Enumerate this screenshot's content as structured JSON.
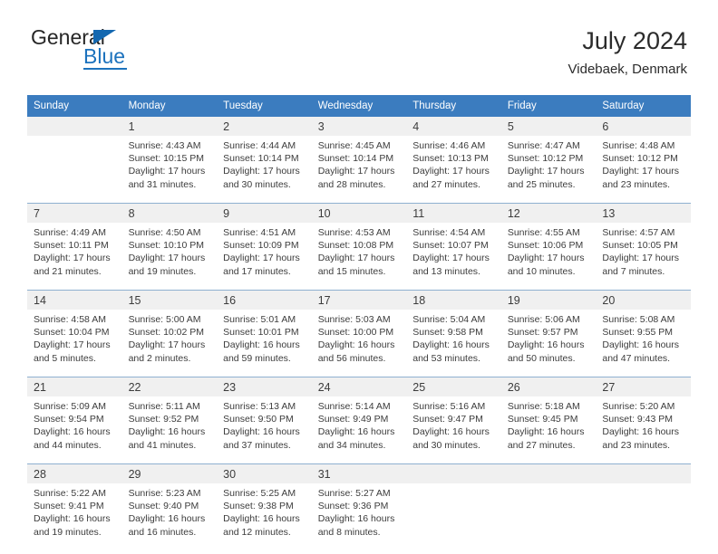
{
  "brand": {
    "name_top": "General",
    "name_bottom": "Blue",
    "accent_color": "#1c72bd"
  },
  "header": {
    "title": "July 2024",
    "subtitle": "Videbaek, Denmark"
  },
  "theme": {
    "header_blue": "#3b7cbf",
    "daynum_bg": "#f0f0f0",
    "row_divider": "#8fb0d0",
    "text": "#3c3c3c"
  },
  "calendar": {
    "weekday_headers": [
      "Sunday",
      "Monday",
      "Tuesday",
      "Wednesday",
      "Thursday",
      "Friday",
      "Saturday"
    ],
    "weeks": [
      [
        {
          "day": "",
          "sunrise": "",
          "sunset": "",
          "daylight_1": "",
          "daylight_2": ""
        },
        {
          "day": "1",
          "sunrise": "Sunrise: 4:43 AM",
          "sunset": "Sunset: 10:15 PM",
          "daylight_1": "Daylight: 17 hours",
          "daylight_2": "and 31 minutes."
        },
        {
          "day": "2",
          "sunrise": "Sunrise: 4:44 AM",
          "sunset": "Sunset: 10:14 PM",
          "daylight_1": "Daylight: 17 hours",
          "daylight_2": "and 30 minutes."
        },
        {
          "day": "3",
          "sunrise": "Sunrise: 4:45 AM",
          "sunset": "Sunset: 10:14 PM",
          "daylight_1": "Daylight: 17 hours",
          "daylight_2": "and 28 minutes."
        },
        {
          "day": "4",
          "sunrise": "Sunrise: 4:46 AM",
          "sunset": "Sunset: 10:13 PM",
          "daylight_1": "Daylight: 17 hours",
          "daylight_2": "and 27 minutes."
        },
        {
          "day": "5",
          "sunrise": "Sunrise: 4:47 AM",
          "sunset": "Sunset: 10:12 PM",
          "daylight_1": "Daylight: 17 hours",
          "daylight_2": "and 25 minutes."
        },
        {
          "day": "6",
          "sunrise": "Sunrise: 4:48 AM",
          "sunset": "Sunset: 10:12 PM",
          "daylight_1": "Daylight: 17 hours",
          "daylight_2": "and 23 minutes."
        }
      ],
      [
        {
          "day": "7",
          "sunrise": "Sunrise: 4:49 AM",
          "sunset": "Sunset: 10:11 PM",
          "daylight_1": "Daylight: 17 hours",
          "daylight_2": "and 21 minutes."
        },
        {
          "day": "8",
          "sunrise": "Sunrise: 4:50 AM",
          "sunset": "Sunset: 10:10 PM",
          "daylight_1": "Daylight: 17 hours",
          "daylight_2": "and 19 minutes."
        },
        {
          "day": "9",
          "sunrise": "Sunrise: 4:51 AM",
          "sunset": "Sunset: 10:09 PM",
          "daylight_1": "Daylight: 17 hours",
          "daylight_2": "and 17 minutes."
        },
        {
          "day": "10",
          "sunrise": "Sunrise: 4:53 AM",
          "sunset": "Sunset: 10:08 PM",
          "daylight_1": "Daylight: 17 hours",
          "daylight_2": "and 15 minutes."
        },
        {
          "day": "11",
          "sunrise": "Sunrise: 4:54 AM",
          "sunset": "Sunset: 10:07 PM",
          "daylight_1": "Daylight: 17 hours",
          "daylight_2": "and 13 minutes."
        },
        {
          "day": "12",
          "sunrise": "Sunrise: 4:55 AM",
          "sunset": "Sunset: 10:06 PM",
          "daylight_1": "Daylight: 17 hours",
          "daylight_2": "and 10 minutes."
        },
        {
          "day": "13",
          "sunrise": "Sunrise: 4:57 AM",
          "sunset": "Sunset: 10:05 PM",
          "daylight_1": "Daylight: 17 hours",
          "daylight_2": "and 7 minutes."
        }
      ],
      [
        {
          "day": "14",
          "sunrise": "Sunrise: 4:58 AM",
          "sunset": "Sunset: 10:04 PM",
          "daylight_1": "Daylight: 17 hours",
          "daylight_2": "and 5 minutes."
        },
        {
          "day": "15",
          "sunrise": "Sunrise: 5:00 AM",
          "sunset": "Sunset: 10:02 PM",
          "daylight_1": "Daylight: 17 hours",
          "daylight_2": "and 2 minutes."
        },
        {
          "day": "16",
          "sunrise": "Sunrise: 5:01 AM",
          "sunset": "Sunset: 10:01 PM",
          "daylight_1": "Daylight: 16 hours",
          "daylight_2": "and 59 minutes."
        },
        {
          "day": "17",
          "sunrise": "Sunrise: 5:03 AM",
          "sunset": "Sunset: 10:00 PM",
          "daylight_1": "Daylight: 16 hours",
          "daylight_2": "and 56 minutes."
        },
        {
          "day": "18",
          "sunrise": "Sunrise: 5:04 AM",
          "sunset": "Sunset: 9:58 PM",
          "daylight_1": "Daylight: 16 hours",
          "daylight_2": "and 53 minutes."
        },
        {
          "day": "19",
          "sunrise": "Sunrise: 5:06 AM",
          "sunset": "Sunset: 9:57 PM",
          "daylight_1": "Daylight: 16 hours",
          "daylight_2": "and 50 minutes."
        },
        {
          "day": "20",
          "sunrise": "Sunrise: 5:08 AM",
          "sunset": "Sunset: 9:55 PM",
          "daylight_1": "Daylight: 16 hours",
          "daylight_2": "and 47 minutes."
        }
      ],
      [
        {
          "day": "21",
          "sunrise": "Sunrise: 5:09 AM",
          "sunset": "Sunset: 9:54 PM",
          "daylight_1": "Daylight: 16 hours",
          "daylight_2": "and 44 minutes."
        },
        {
          "day": "22",
          "sunrise": "Sunrise: 5:11 AM",
          "sunset": "Sunset: 9:52 PM",
          "daylight_1": "Daylight: 16 hours",
          "daylight_2": "and 41 minutes."
        },
        {
          "day": "23",
          "sunrise": "Sunrise: 5:13 AM",
          "sunset": "Sunset: 9:50 PM",
          "daylight_1": "Daylight: 16 hours",
          "daylight_2": "and 37 minutes."
        },
        {
          "day": "24",
          "sunrise": "Sunrise: 5:14 AM",
          "sunset": "Sunset: 9:49 PM",
          "daylight_1": "Daylight: 16 hours",
          "daylight_2": "and 34 minutes."
        },
        {
          "day": "25",
          "sunrise": "Sunrise: 5:16 AM",
          "sunset": "Sunset: 9:47 PM",
          "daylight_1": "Daylight: 16 hours",
          "daylight_2": "and 30 minutes."
        },
        {
          "day": "26",
          "sunrise": "Sunrise: 5:18 AM",
          "sunset": "Sunset: 9:45 PM",
          "daylight_1": "Daylight: 16 hours",
          "daylight_2": "and 27 minutes."
        },
        {
          "day": "27",
          "sunrise": "Sunrise: 5:20 AM",
          "sunset": "Sunset: 9:43 PM",
          "daylight_1": "Daylight: 16 hours",
          "daylight_2": "and 23 minutes."
        }
      ],
      [
        {
          "day": "28",
          "sunrise": "Sunrise: 5:22 AM",
          "sunset": "Sunset: 9:41 PM",
          "daylight_1": "Daylight: 16 hours",
          "daylight_2": "and 19 minutes."
        },
        {
          "day": "29",
          "sunrise": "Sunrise: 5:23 AM",
          "sunset": "Sunset: 9:40 PM",
          "daylight_1": "Daylight: 16 hours",
          "daylight_2": "and 16 minutes."
        },
        {
          "day": "30",
          "sunrise": "Sunrise: 5:25 AM",
          "sunset": "Sunset: 9:38 PM",
          "daylight_1": "Daylight: 16 hours",
          "daylight_2": "and 12 minutes."
        },
        {
          "day": "31",
          "sunrise": "Sunrise: 5:27 AM",
          "sunset": "Sunset: 9:36 PM",
          "daylight_1": "Daylight: 16 hours",
          "daylight_2": "and 8 minutes."
        },
        {
          "day": "",
          "sunrise": "",
          "sunset": "",
          "daylight_1": "",
          "daylight_2": ""
        },
        {
          "day": "",
          "sunrise": "",
          "sunset": "",
          "daylight_1": "",
          "daylight_2": ""
        },
        {
          "day": "",
          "sunrise": "",
          "sunset": "",
          "daylight_1": "",
          "daylight_2": ""
        }
      ]
    ]
  }
}
